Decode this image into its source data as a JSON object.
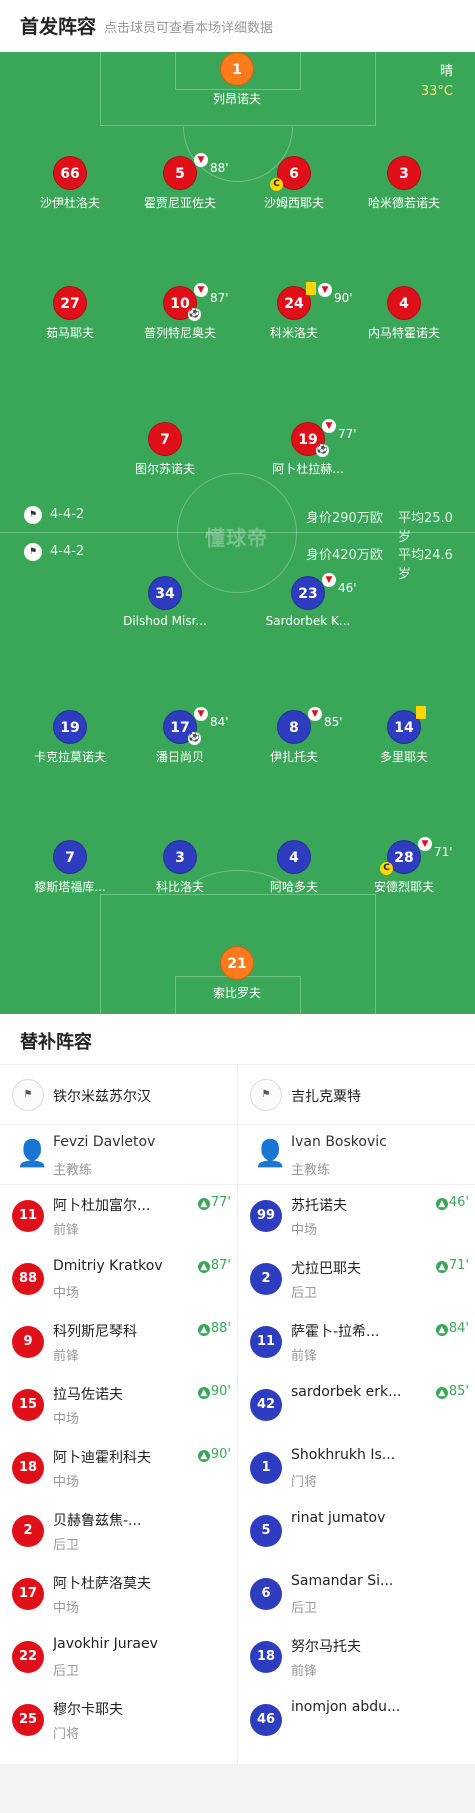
{
  "header": {
    "title": "首发阵容",
    "subtitle": "点击球员可查看本场详细数据"
  },
  "weather": {
    "condition": "晴",
    "temperature": "33°C"
  },
  "watermark": "懂球帝",
  "home_team": {
    "formation": "4-4-2",
    "value": "身价290万欧",
    "avg_age": "平均25.0岁",
    "players": [
      {
        "num": "1",
        "name": "列昂诺夫",
        "color": "orange"
      },
      {
        "num": "66",
        "name": "沙伊杜洛夫",
        "color": "red"
      },
      {
        "num": "5",
        "name": "霍贾尼亚佐夫",
        "color": "red",
        "sub_min": "88'"
      },
      {
        "num": "6",
        "name": "沙姆西耶夫",
        "color": "red",
        "captain": "C"
      },
      {
        "num": "3",
        "name": "哈米德若诺夫",
        "color": "red"
      },
      {
        "num": "27",
        "name": "茹马耶夫",
        "color": "red"
      },
      {
        "num": "10",
        "name": "普列特尼奥夫",
        "color": "red",
        "sub_min": "87'",
        "goal": true
      },
      {
        "num": "24",
        "name": "科米洛夫",
        "color": "red",
        "sub_min": "90'",
        "yellow": true
      },
      {
        "num": "4",
        "name": "内马特霍诺夫",
        "color": "red"
      },
      {
        "num": "7",
        "name": "图尔苏诺夫",
        "color": "red"
      },
      {
        "num": "19",
        "name": "阿卜杜拉赫...",
        "color": "red",
        "sub_min": "77'",
        "goal": true
      }
    ]
  },
  "away_team": {
    "formation": "4-4-2",
    "value": "身价420万欧",
    "avg_age": "平均24.6岁",
    "players": [
      {
        "num": "34",
        "name": "Dilshod Misr...",
        "color": "blue"
      },
      {
        "num": "23",
        "name": "Sardorbek K...",
        "color": "blue",
        "sub_min": "46'"
      },
      {
        "num": "19",
        "name": "卡克拉莫诺夫",
        "color": "blue"
      },
      {
        "num": "17",
        "name": "潘日尚贝",
        "color": "blue",
        "sub_min": "84'",
        "goal": true
      },
      {
        "num": "8",
        "name": "伊扎托夫",
        "color": "blue",
        "sub_min": "85'"
      },
      {
        "num": "14",
        "name": "多里耶夫",
        "color": "blue",
        "yellow": true
      },
      {
        "num": "7",
        "name": "穆斯塔福库...",
        "color": "blue"
      },
      {
        "num": "3",
        "name": "科比洛夫",
        "color": "blue"
      },
      {
        "num": "4",
        "name": "阿哈多夫",
        "color": "blue"
      },
      {
        "num": "28",
        "name": "安德烈耶夫",
        "color": "blue",
        "sub_min": "71'",
        "captain": "C"
      },
      {
        "num": "21",
        "name": "索比罗夫",
        "color": "orange"
      }
    ]
  },
  "subs": {
    "title": "替补阵容",
    "left": {
      "team_name": "铁尔米兹苏尔汉",
      "coach": {
        "name": "Fevzi Davletov",
        "role": "主教练"
      },
      "players": [
        {
          "num": "11",
          "name": "阿卜杜加富尔...",
          "pos": "前锋",
          "in": "77'"
        },
        {
          "num": "88",
          "name": "Dmitriy Kratkov",
          "pos": "中场",
          "in": "87'"
        },
        {
          "num": "9",
          "name": "科列斯尼琴科",
          "pos": "前锋",
          "in": "88'"
        },
        {
          "num": "15",
          "name": "拉马佐诺夫",
          "pos": "中场",
          "in": "90'"
        },
        {
          "num": "18",
          "name": "阿卜迪霍利科夫",
          "pos": "中场",
          "in": "90'"
        },
        {
          "num": "2",
          "name": "贝赫鲁兹焦-...",
          "pos": "后卫",
          "in": ""
        },
        {
          "num": "17",
          "name": "阿卜杜萨洛莫夫",
          "pos": "中场",
          "in": ""
        },
        {
          "num": "22",
          "name": "Javokhir Juraev",
          "pos": "后卫",
          "in": ""
        },
        {
          "num": "25",
          "name": "穆尔卡耶夫",
          "pos": "门将",
          "in": ""
        }
      ]
    },
    "right": {
      "team_name": "吉扎克粟特",
      "coach": {
        "name": "Ivan Boskovic",
        "role": "主教练"
      },
      "players": [
        {
          "num": "99",
          "name": "苏托诺夫",
          "pos": "中场",
          "in": "46'"
        },
        {
          "num": "2",
          "name": "尤拉巴耶夫",
          "pos": "后卫",
          "in": "71'"
        },
        {
          "num": "11",
          "name": "萨霍卜-拉希...",
          "pos": "前锋",
          "in": "84'"
        },
        {
          "num": "42",
          "name": "sardorbek erk...",
          "pos": "",
          "in": "85'"
        },
        {
          "num": "1",
          "name": "Shokhrukh Is...",
          "pos": "门将",
          "in": ""
        },
        {
          "num": "5",
          "name": "rinat jumatov",
          "pos": "",
          "in": ""
        },
        {
          "num": "6",
          "name": "Samandar Si...",
          "pos": "后卫",
          "in": ""
        },
        {
          "num": "18",
          "name": "努尔马托夫",
          "pos": "前锋",
          "in": ""
        },
        {
          "num": "46",
          "name": "inomjon abdu...",
          "pos": "",
          "in": ""
        }
      ]
    }
  }
}
